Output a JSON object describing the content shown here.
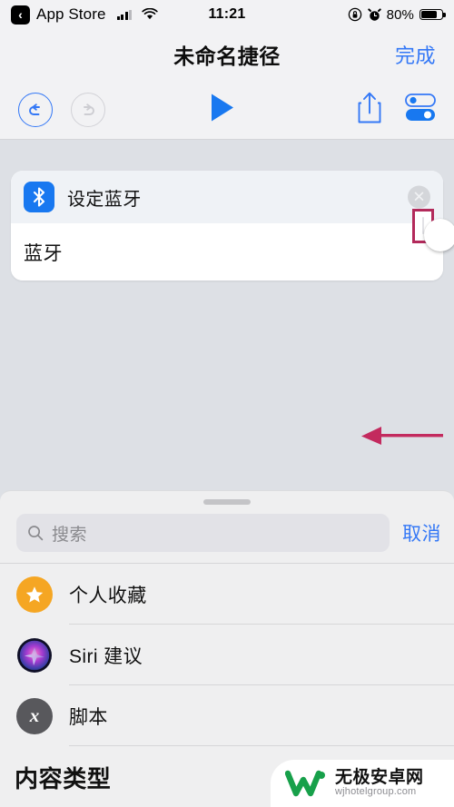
{
  "status_bar": {
    "back_app": "App Store",
    "back_icon": "chevron-left-icon",
    "signal_icon": "cellular-signal-icon",
    "wifi_icon": "wifi-icon",
    "time": "11:21",
    "rotation_lock_icon": "rotation-lock-icon",
    "alarm_icon": "alarm-clock-icon",
    "battery_percent": "80%",
    "battery_icon": "battery-icon",
    "battery_level": 80
  },
  "nav_bar": {
    "title": "未命名捷径",
    "done_label": "完成",
    "accent_color": "#3478f6"
  },
  "toolbar": {
    "undo_icon": "undo-icon",
    "redo_icon": "redo-icon",
    "play_icon": "play-icon",
    "share_icon": "share-icon",
    "settings_icon": "toggles-settings-icon",
    "undo_enabled": true,
    "redo_enabled": false
  },
  "action_card": {
    "icon": "bluetooth-icon",
    "icon_color": "#1878f0",
    "header_label": "设定蓝牙",
    "close_icon": "close-circle-icon",
    "row_label": "蓝牙",
    "toggle_state": "off",
    "highlight_color": "#b32a5b"
  },
  "annotation": {
    "arrow_icon": "arrow-left-icon",
    "arrow_color": "#c32a5e"
  },
  "sheet": {
    "grabber_icon": "drag-handle-icon",
    "search": {
      "icon": "search-icon",
      "placeholder": "搜索",
      "value": ""
    },
    "cancel_label": "取消",
    "items": [
      {
        "label": "个人收藏",
        "icon": "star-icon"
      },
      {
        "label": "Siri 建议",
        "icon": "siri-orb-icon"
      },
      {
        "label": "脚本",
        "icon": "script-x-icon"
      }
    ],
    "section_title": "内容类型"
  },
  "watermark": {
    "logo_icon": "w-logo-icon",
    "name": "无极安卓网",
    "url": "wjhotelgroup.com",
    "color": "#17a04a"
  }
}
